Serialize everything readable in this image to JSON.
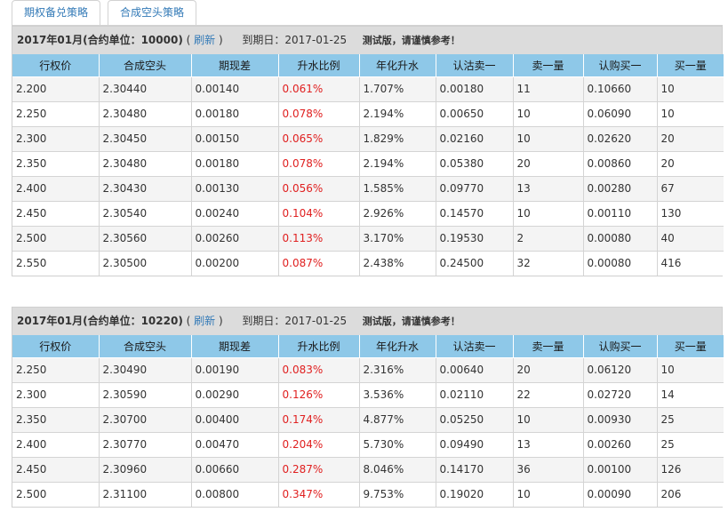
{
  "tabs": [
    "期权备兑策略",
    "合成空头策略"
  ],
  "columns": [
    "行权价",
    "合成空头",
    "期现差",
    "升水比例",
    "年化升水",
    "认沽卖一",
    "卖一量",
    "认购买一",
    "买一量"
  ],
  "panels": [
    {
      "title": "2017年01月(合约单位：10000)",
      "paren_open": "(",
      "refresh": "刷新",
      "paren_close": ")",
      "expire_label": "到期日：2017-01-25",
      "note": "测试版，请谨慎参考！",
      "rows": [
        [
          "2.200",
          "2.30440",
          "0.00140",
          "0.061%",
          "1.707%",
          "0.00180",
          "11",
          "0.10660",
          "10"
        ],
        [
          "2.250",
          "2.30480",
          "0.00180",
          "0.078%",
          "2.194%",
          "0.00650",
          "10",
          "0.06090",
          "10"
        ],
        [
          "2.300",
          "2.30450",
          "0.00150",
          "0.065%",
          "1.829%",
          "0.02160",
          "10",
          "0.02620",
          "20"
        ],
        [
          "2.350",
          "2.30480",
          "0.00180",
          "0.078%",
          "2.194%",
          "0.05380",
          "20",
          "0.00860",
          "20"
        ],
        [
          "2.400",
          "2.30430",
          "0.00130",
          "0.056%",
          "1.585%",
          "0.09770",
          "13",
          "0.00280",
          "67"
        ],
        [
          "2.450",
          "2.30540",
          "0.00240",
          "0.104%",
          "2.926%",
          "0.14570",
          "10",
          "0.00110",
          "130"
        ],
        [
          "2.500",
          "2.30560",
          "0.00260",
          "0.113%",
          "3.170%",
          "0.19530",
          "2",
          "0.00080",
          "40"
        ],
        [
          "2.550",
          "2.30500",
          "0.00200",
          "0.087%",
          "2.438%",
          "0.24500",
          "32",
          "0.00080",
          "416"
        ]
      ]
    },
    {
      "title": "2017年01月(合约单位：10220)",
      "paren_open": "(",
      "refresh": "刷新",
      "paren_close": ")",
      "expire_label": "到期日：2017-01-25",
      "note": "测试版，请谨慎参考！",
      "rows": [
        [
          "2.250",
          "2.30490",
          "0.00190",
          "0.083%",
          "2.316%",
          "0.00640",
          "20",
          "0.06120",
          "10"
        ],
        [
          "2.300",
          "2.30590",
          "0.00290",
          "0.126%",
          "3.536%",
          "0.02110",
          "22",
          "0.02720",
          "14"
        ],
        [
          "2.350",
          "2.30700",
          "0.00400",
          "0.174%",
          "4.877%",
          "0.05250",
          "10",
          "0.00930",
          "25"
        ],
        [
          "2.400",
          "2.30770",
          "0.00470",
          "0.204%",
          "5.730%",
          "0.09490",
          "13",
          "0.00260",
          "25"
        ],
        [
          "2.450",
          "2.30960",
          "0.00660",
          "0.287%",
          "8.046%",
          "0.14170",
          "36",
          "0.00100",
          "126"
        ],
        [
          "2.500",
          "2.31100",
          "0.00800",
          "0.347%",
          "9.753%",
          "0.19020",
          "10",
          "0.00090",
          "206"
        ]
      ]
    }
  ],
  "colors": {
    "header_bg": "#8ec8e8",
    "panel_head_bg": "#dcdcdc",
    "premium_text": "#e02020",
    "link": "#337ab7"
  }
}
